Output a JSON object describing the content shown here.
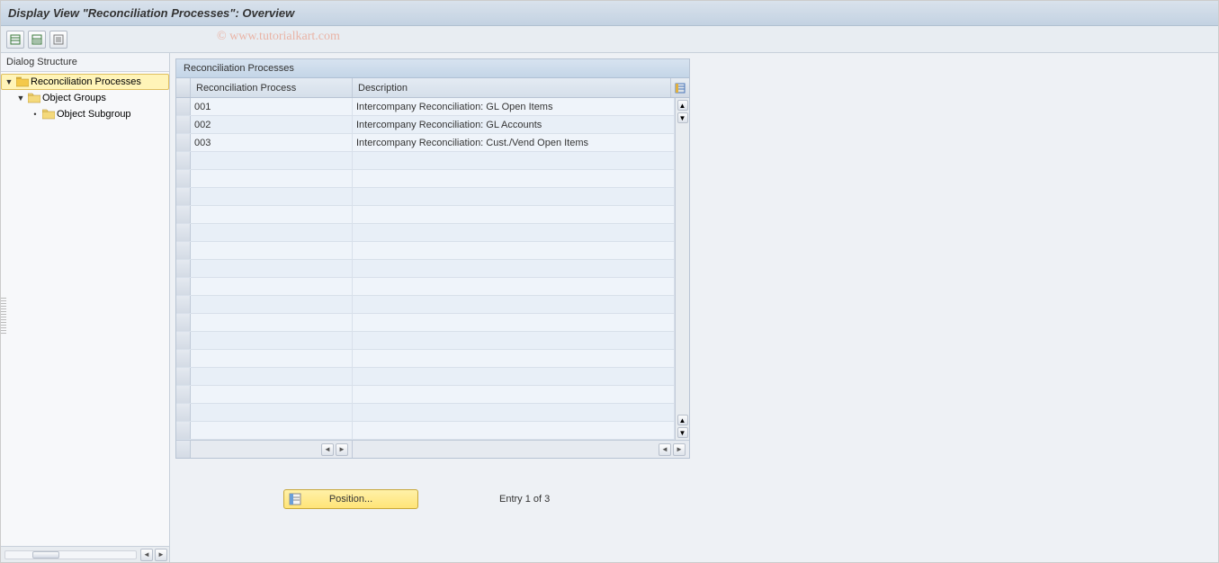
{
  "title": "Display View \"Reconciliation Processes\": Overview",
  "watermark": "© www.tutorialkart.com",
  "dialog_structure": {
    "label": "Dialog Structure",
    "nodes": {
      "root": "Reconciliation Processes",
      "child1": "Object Groups",
      "child2": "Object Subgroup"
    }
  },
  "grid": {
    "title": "Reconciliation Processes",
    "columns": {
      "process": "Reconciliation Process",
      "description": "Description"
    },
    "rows": [
      {
        "process": "001",
        "description": "Intercompany Reconciliation: GL Open Items"
      },
      {
        "process": "002",
        "description": "Intercompany Reconciliation: GL Accounts"
      },
      {
        "process": "003",
        "description": "Intercompany Reconciliation: Cust./Vend Open Items"
      }
    ]
  },
  "footer": {
    "position_btn": "Position...",
    "entry_text": "Entry 1 of 3"
  }
}
